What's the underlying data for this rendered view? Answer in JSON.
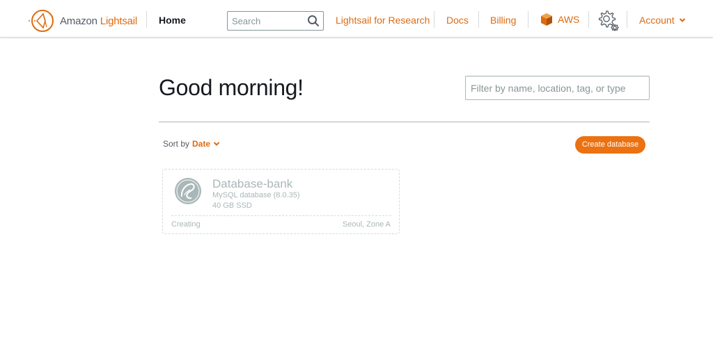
{
  "header": {
    "brand_prefix": "Amazon",
    "brand_name": "Lightsail",
    "home_label": "Home",
    "search_placeholder": "Search",
    "nav": {
      "research": "Lightsail for Research",
      "docs": "Docs",
      "billing": "Billing",
      "aws": "AWS",
      "account": "Account"
    },
    "icons": {
      "logo": "lightsail-logo-icon",
      "search": "search-icon",
      "aws": "aws-cube-icon",
      "settings": "gear-icon",
      "account_caret": "chevron-down-icon"
    }
  },
  "main": {
    "greeting": "Good morning!",
    "filter_placeholder": "Filter by name, location, tag, or type",
    "sort": {
      "label": "Sort by",
      "value": "Date"
    },
    "create_button": "Create database",
    "databases": [
      {
        "name": "Database-bank",
        "engine": "MySQL database (8.0.35)",
        "storage": "40 GB SSD",
        "status": "Creating",
        "location": "Seoul, Zone A",
        "icon": "mysql-database-icon"
      }
    ]
  },
  "colors": {
    "accent": "#dd6b10",
    "button": "#ec7211",
    "muted": "#aab7b8",
    "text": "#16191f"
  }
}
